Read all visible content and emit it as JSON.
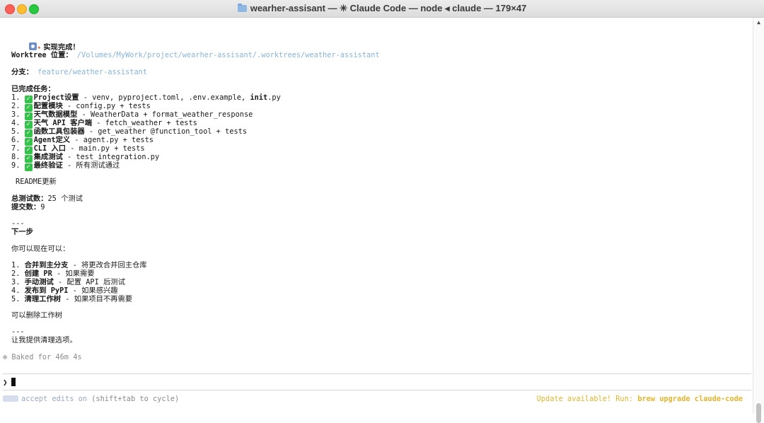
{
  "window": {
    "title": "wearher-assisant — ✳ Claude Code — node ◂ claude — 179×47"
  },
  "colors": {
    "path": "#8ab4d8",
    "check": "#35c24a",
    "update": "#e3b52e",
    "dim": "#8a8a8a"
  },
  "output": {
    "heading": "实现完成！",
    "worktree_label": "Worktree 位置：",
    "worktree_path": "/Volumes/MyWork/project/wearher-assisant/.worktrees/weather-assistant",
    "branch_label": "分支：",
    "branch_value": "feature/weather-assistant",
    "tasks_heading": "已完成任务：",
    "tasks": [
      {
        "num": "1.",
        "name": "Project设置",
        "desc": " - venv, pyproject.toml, .env.example, ",
        "extra_bold": "init",
        "extra": ".py"
      },
      {
        "num": "2.",
        "name": "配置模块",
        "desc": " - config.py + tests"
      },
      {
        "num": "3.",
        "name": "天气数据模型",
        "desc": " - WeatherData + format_weather_response"
      },
      {
        "num": "4.",
        "name": "天气 API 客户端",
        "desc": " - fetch_weather + tests"
      },
      {
        "num": "5.",
        "name": "函数工具包装器",
        "desc": " - get_weather @function_tool + tests"
      },
      {
        "num": "6.",
        "name": "Agent定义",
        "desc": " - agent.py + tests"
      },
      {
        "num": "7.",
        "name": "CLI 入口",
        "desc": " - main.py + tests"
      },
      {
        "num": "8.",
        "name": "集成测试",
        "desc": " - test_integration.py"
      },
      {
        "num": "9.",
        "name": "最终验证",
        "desc": " - 所有测试通过"
      }
    ],
    "readme": "README更新",
    "total_tests_label": "总测试数：",
    "total_tests_value": "25 个测试",
    "commits_label": "提交数：",
    "commits_value": "9",
    "hr1": "---",
    "next_heading": "下一步",
    "next_intro": "你可以现在可以：",
    "next_steps": [
      {
        "num": "1.",
        "name": "合并到主分支",
        "desc": " - 将更改合并回主仓库"
      },
      {
        "num": "2.",
        "name": "创建 PR",
        "desc": " - 如果需要"
      },
      {
        "num": "3.",
        "name": "手动测试",
        "desc": " - 配置 API 后测试"
      },
      {
        "num": "4.",
        "name": "发布到 PyPI",
        "desc": " - 如果感兴趣"
      },
      {
        "num": "5.",
        "name": "清理工作树",
        "desc": " - 如果项目不再需要"
      }
    ],
    "cleanup_note": "可以删除工作树",
    "hr2": "---",
    "offer": "让我提供清理选项。",
    "baked": "✻ Baked for 46m 4s"
  },
  "prompt": {
    "caret": "❯"
  },
  "status": {
    "mode": "accept edits on",
    "hint": " (shift+tab to cycle)",
    "update_text": "Update available! Run: ",
    "update_cmd": "brew upgrade claude-code"
  },
  "icons": {
    "title_folder": "folder-icon",
    "done": "done-icon",
    "party": "party-popper-icon",
    "check": "check-mark-icon",
    "scroll_up": "chevron-up-icon",
    "mode": "accept-edits-icon"
  }
}
